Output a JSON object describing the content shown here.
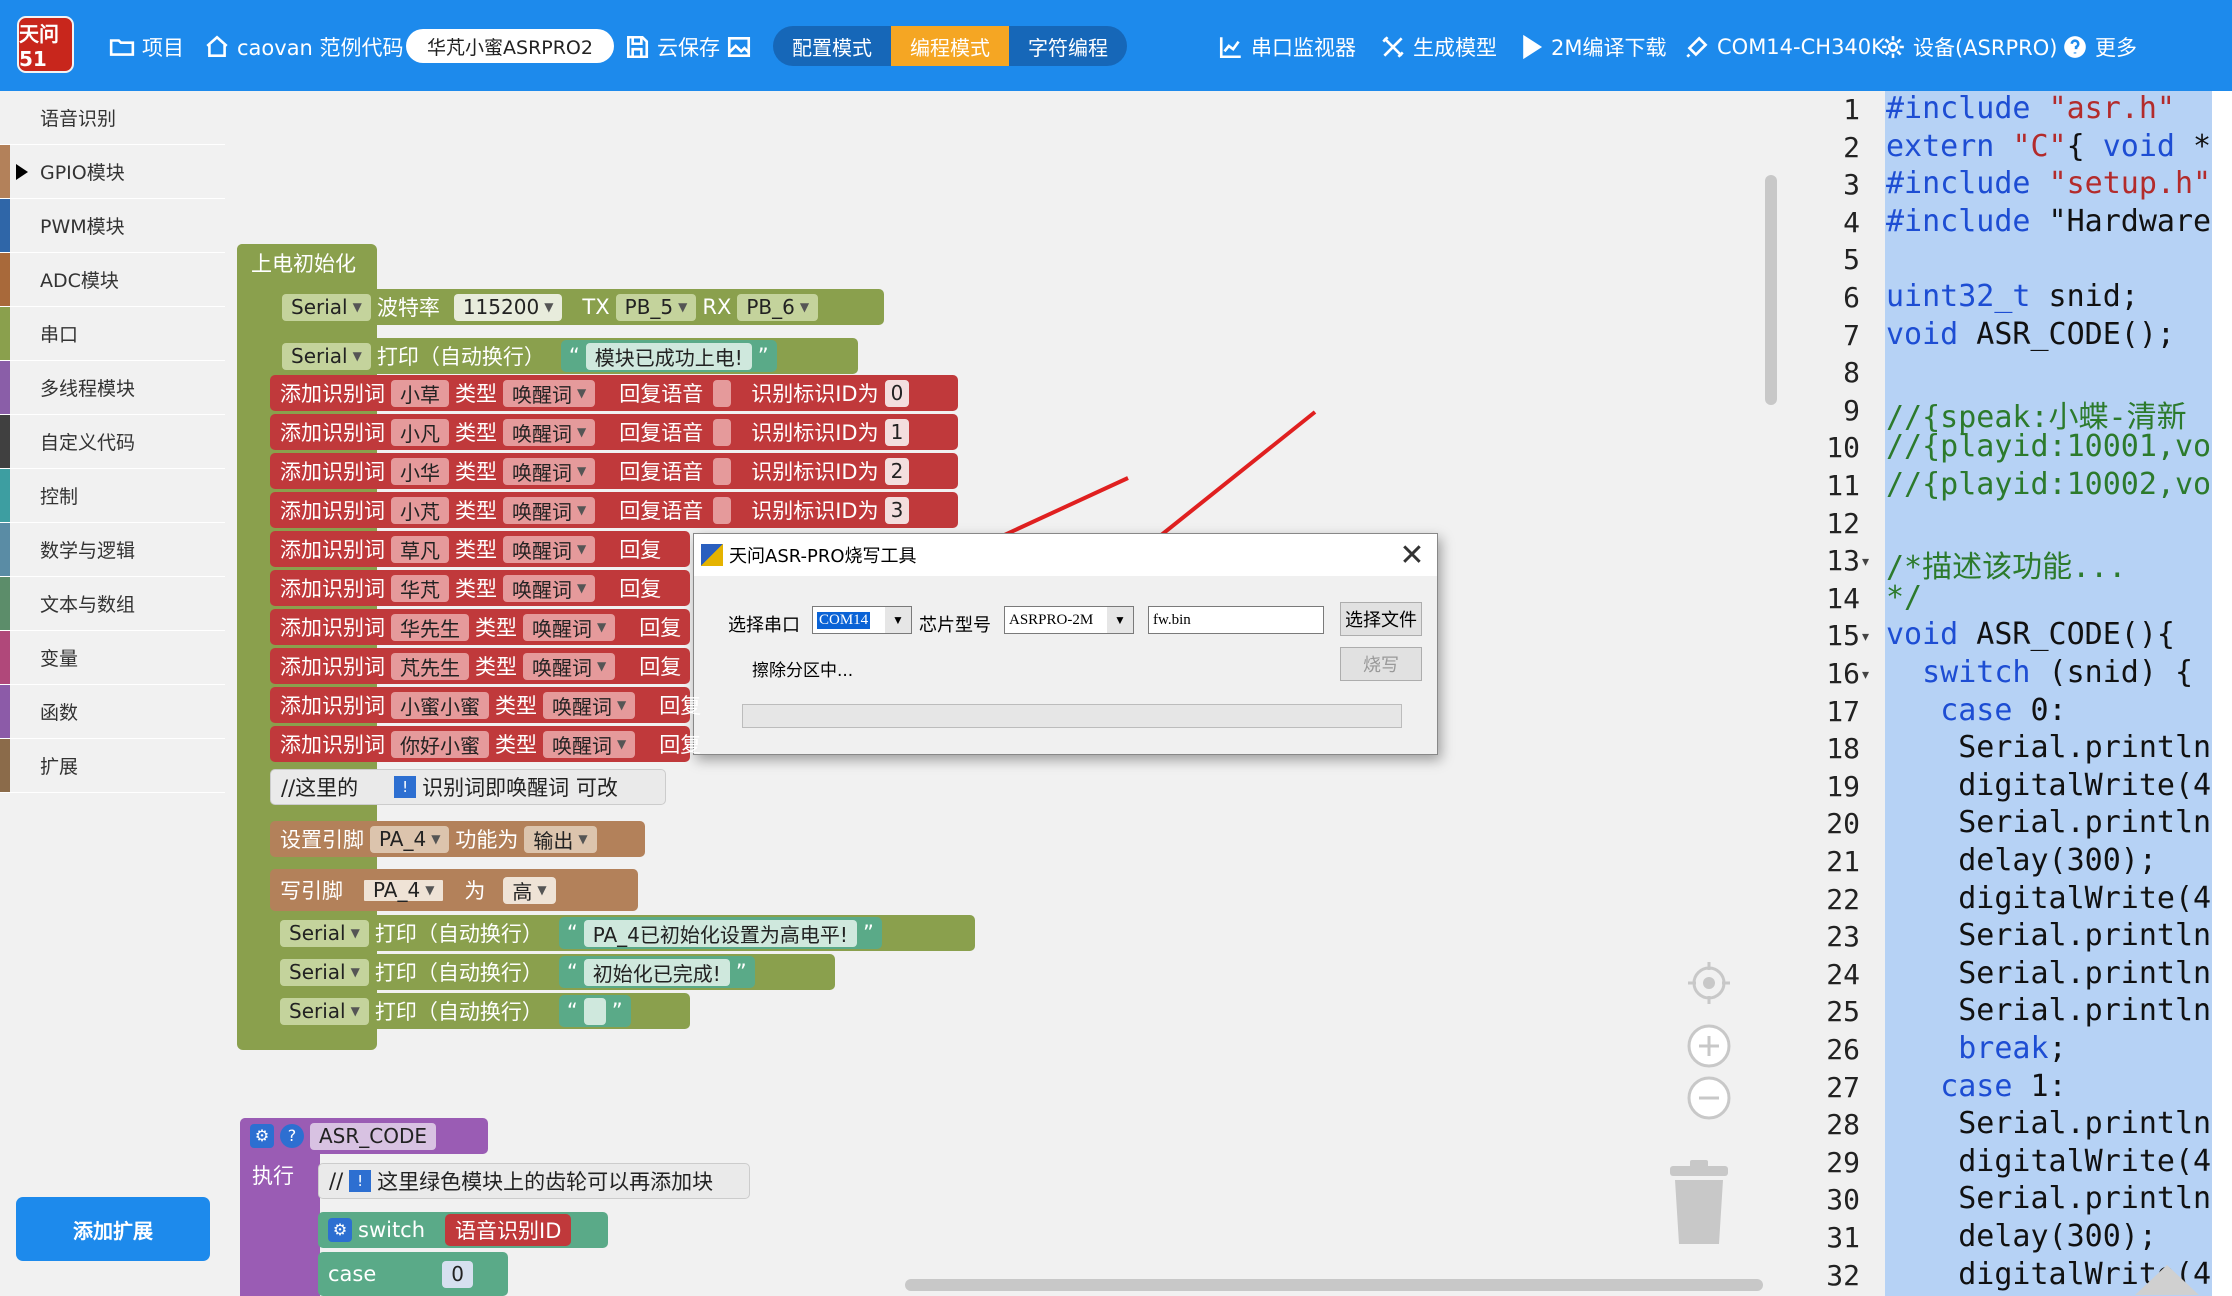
{
  "topbar": {
    "logo_text": "天问51",
    "items": [
      {
        "label": "项目",
        "icon": "folder-icon"
      },
      {
        "label": "caovan 范例代码",
        "icon": "home-icon"
      }
    ],
    "project_name": "华芃小蜜ASRPRO2",
    "save_label": "云保存",
    "modes": [
      "配置模式",
      "编程模式",
      "字符编程"
    ],
    "active_mode": "编程模式",
    "right_items": [
      {
        "label": "串口监视器",
        "icon": "chart-icon"
      },
      {
        "label": "生成模型",
        "icon": "tools-icon"
      },
      {
        "label": "2M编译下载",
        "icon": "play-icon"
      },
      {
        "label": "COM14-CH340K",
        "icon": "usb-icon"
      },
      {
        "label": "设备(ASRPRO)",
        "icon": "gear-icon"
      },
      {
        "label": "更多",
        "icon": "help-icon"
      }
    ]
  },
  "sidebar": {
    "categories": [
      {
        "label": "语音识别",
        "color": "#f1f1f1"
      },
      {
        "label": "GPIO模块",
        "color": "#b3815a"
      },
      {
        "label": "PWM模块",
        "color": "#2f66a8"
      },
      {
        "label": "ADC模块",
        "color": "#a8693a"
      },
      {
        "label": "串口",
        "color": "#8aa04d"
      },
      {
        "label": "多线程模块",
        "color": "#8a5ea8"
      },
      {
        "label": "自定义代码",
        "color": "#404040"
      },
      {
        "label": "控制",
        "color": "#3d9ea1"
      },
      {
        "label": "数学与逻辑",
        "color": "#5a8ca5"
      },
      {
        "label": "文本与数组",
        "color": "#5c8d6a"
      },
      {
        "label": "变量",
        "color": "#b0487a"
      },
      {
        "label": "函数",
        "color": "#8c5ba8"
      },
      {
        "label": "扩展",
        "color": "#8b6b4a"
      }
    ],
    "add_extension": "添加扩展"
  },
  "blocks": {
    "init_header": "上电初始化",
    "serial": "Serial",
    "baud_label": "波特率",
    "baud": "115200",
    "tx_label": "TX",
    "tx_pin": "PB_5",
    "rx_label": "RX",
    "rx_pin": "PB_6",
    "print_label": "打印（自动换行）",
    "msg_power": "模块已成功上电!",
    "add_word": "添加识别词",
    "type_label": "类型",
    "wake": "唤醒词",
    "reply_label": "回复语音",
    "id_label": "识别标识ID为",
    "words": [
      {
        "word": "小草",
        "id": "0"
      },
      {
        "word": "小凡",
        "id": "1"
      },
      {
        "word": "小华",
        "id": "2"
      },
      {
        "word": "小芃",
        "id": "3"
      },
      {
        "word": "草凡",
        "id": ""
      },
      {
        "word": "华芃",
        "id": ""
      },
      {
        "word": "华先生",
        "id": ""
      },
      {
        "word": "芃先生",
        "id": ""
      },
      {
        "word": "小蜜小蜜",
        "id": ""
      },
      {
        "word": "你好小蜜",
        "id": ""
      }
    ],
    "reply_short": "回复",
    "comment1_prefix": "//这里的",
    "comment1_text": "识别词即唤醒词 可改",
    "set_pin": "设置引脚",
    "pin_pa4": "PA_4",
    "func_label": "功能为",
    "output": "输出",
    "write_pin": "写引脚",
    "as_label": "为",
    "high": "高",
    "msg_pa4": "PA_4已初始化设置为高电平!",
    "msg_done": "初始化已完成!",
    "msg_empty": "",
    "asr_func": "ASR_CODE",
    "exec_label": "执行",
    "comment2_prefix": "//",
    "comment2_text": "这里绿色模块上的齿轮可以再添加块",
    "switch_label": "switch",
    "asr_id": "语音识别ID",
    "case_label": "case",
    "case_val": "0"
  },
  "dialog": {
    "title": "天问ASR-PRO烧写工具",
    "port_label": "选择串口",
    "port_value": "COM14",
    "chip_label": "芯片型号",
    "chip_value": "ASRPRO-2M",
    "file_value": "fw.bin",
    "choose_file": "选择文件",
    "burn": "烧写",
    "status": "擦除分区中...",
    "progress": 0
  },
  "editor": {
    "lines": [
      {
        "n": "1",
        "text": "#include \"asr.h\"",
        "fold": ""
      },
      {
        "n": "2",
        "text": "extern \"C\"{ void *",
        "fold": ""
      },
      {
        "n": "3",
        "text": "#include \"setup.h\"",
        "fold": ""
      },
      {
        "n": "4",
        "text": "#include \"Hardware",
        "fold": ""
      },
      {
        "n": "5",
        "text": "",
        "fold": ""
      },
      {
        "n": "6",
        "text": "uint32_t snid;",
        "fold": ""
      },
      {
        "n": "7",
        "text": "void ASR_CODE();",
        "fold": ""
      },
      {
        "n": "8",
        "text": "",
        "fold": ""
      },
      {
        "n": "9",
        "text": "//{speak:小蝶-清新",
        "fold": ""
      },
      {
        "n": "10",
        "text": "//{playid:10001,vo",
        "fold": ""
      },
      {
        "n": "11",
        "text": "//{playid:10002,vo",
        "fold": ""
      },
      {
        "n": "12",
        "text": "",
        "fold": ""
      },
      {
        "n": "13",
        "text": "/*描述该功能...",
        "fold": "▾"
      },
      {
        "n": "14",
        "text": "*/",
        "fold": ""
      },
      {
        "n": "15",
        "text": "void ASR_CODE(){",
        "fold": "▾"
      },
      {
        "n": "16",
        "text": "  switch (snid) {",
        "fold": "▾"
      },
      {
        "n": "17",
        "text": "   case 0:",
        "fold": ""
      },
      {
        "n": "18",
        "text": "    Serial.println",
        "fold": ""
      },
      {
        "n": "19",
        "text": "    digitalWrite(4",
        "fold": ""
      },
      {
        "n": "20",
        "text": "    Serial.println",
        "fold": ""
      },
      {
        "n": "21",
        "text": "    delay(300);",
        "fold": ""
      },
      {
        "n": "22",
        "text": "    digitalWrite(4",
        "fold": ""
      },
      {
        "n": "23",
        "text": "    Serial.println",
        "fold": ""
      },
      {
        "n": "24",
        "text": "    Serial.println",
        "fold": ""
      },
      {
        "n": "25",
        "text": "    Serial.println",
        "fold": ""
      },
      {
        "n": "26",
        "text": "    break;",
        "fold": ""
      },
      {
        "n": "27",
        "text": "   case 1:",
        "fold": ""
      },
      {
        "n": "28",
        "text": "    Serial.println",
        "fold": ""
      },
      {
        "n": "29",
        "text": "    digitalWrite(4",
        "fold": ""
      },
      {
        "n": "30",
        "text": "    Serial.println",
        "fold": ""
      },
      {
        "n": "31",
        "text": "    delay(300);",
        "fold": ""
      },
      {
        "n": "32",
        "text": "    digitalWrite(4",
        "fold": ""
      }
    ]
  },
  "colors": {
    "topbar": "#1d8aec",
    "active_mode": "#f5a623",
    "serial_block": "#8aa04d",
    "word_block": "#c0393b",
    "gpio_block": "#b3815a",
    "text_block": "#5aaa88",
    "func_block": "#9a5cb4",
    "arrow": "#e02020"
  }
}
